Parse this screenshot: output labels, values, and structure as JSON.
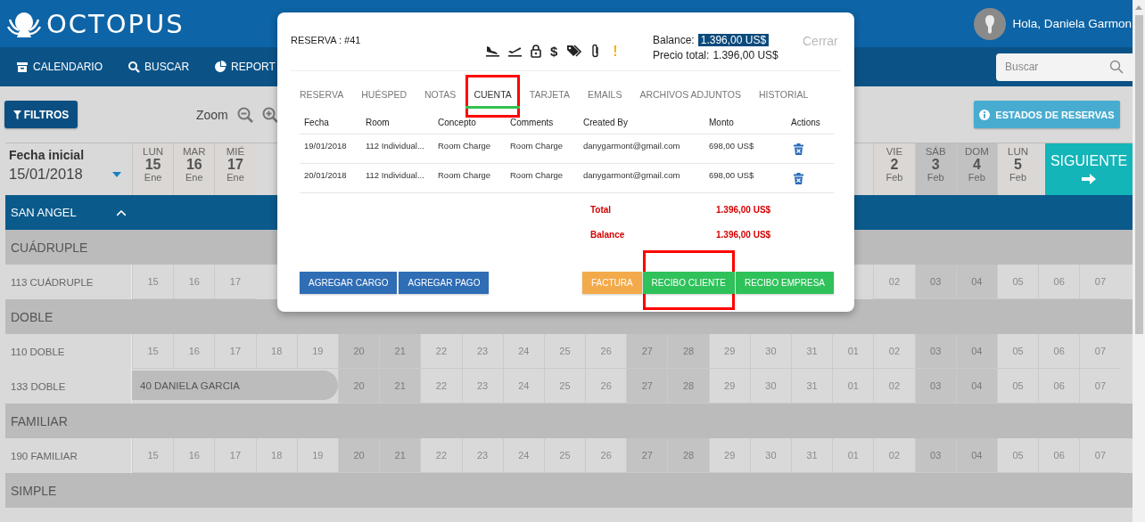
{
  "header": {
    "brand": "OCTOPUS",
    "greeting": "Hola, Daniela Garmon"
  },
  "nav": {
    "items": [
      {
        "label": "CALENDARIO"
      },
      {
        "label": "BUSCAR"
      },
      {
        "label": "REPORT"
      }
    ],
    "search": {
      "placeholder": "Buscar"
    }
  },
  "toolbar": {
    "filter_button": "FILTROS",
    "zoom_label": "Zoom",
    "status_button": "ESTADOS DE RESERVAS"
  },
  "calendar": {
    "start_label": "Fecha inicial",
    "start_date": "15/01/2018",
    "next_button": "SIGUIENTE",
    "days_left": [
      {
        "weekday": "LUN",
        "day": "15",
        "month": "Ene",
        "weekend": false
      },
      {
        "weekday": "MAR",
        "day": "16",
        "month": "Ene",
        "weekend": false
      },
      {
        "weekday": "MIÉ",
        "day": "17",
        "month": "Ene",
        "weekend": false
      }
    ],
    "days_right": [
      {
        "weekday": "VIE",
        "day": "2",
        "month": "Feb",
        "weekend": false
      },
      {
        "weekday": "SÁB",
        "day": "3",
        "month": "Feb",
        "weekend": true
      },
      {
        "weekday": "DOM",
        "day": "4",
        "month": "Feb",
        "weekend": true
      },
      {
        "weekday": "LUN",
        "day": "5",
        "month": "Feb",
        "weekend": false
      }
    ],
    "group": {
      "name": "SAN ANGEL",
      "expanded": true
    },
    "sections": [
      {
        "category": "CUÁDRUPLE",
        "rooms": [
          {
            "name": "113 CUÁDRUPLE",
            "cells_left": [
              {
                "day": "15",
                "weekend": false
              },
              {
                "day": "16",
                "weekend": false
              },
              {
                "day": "17",
                "weekend": false
              }
            ],
            "cells_right": [
              {
                "day": "02",
                "weekend": false
              },
              {
                "day": "03",
                "weekend": true
              },
              {
                "day": "04",
                "weekend": true
              },
              {
                "day": "05",
                "weekend": false
              },
              {
                "day": "06",
                "weekend": false
              },
              {
                "day": "07",
                "weekend": false
              }
            ]
          }
        ]
      },
      {
        "category": "DOBLE",
        "rooms": [
          {
            "name": "110 DOBLE",
            "cells_left": [
              {
                "day": "15",
                "weekend": false
              },
              {
                "day": "16",
                "weekend": false
              },
              {
                "day": "17",
                "weekend": false
              },
              {
                "day": "18",
                "weekend": false
              },
              {
                "day": "19",
                "weekend": false
              },
              {
                "day": "20",
                "weekend": true
              },
              {
                "day": "21",
                "weekend": true
              },
              {
                "day": "22",
                "weekend": false
              },
              {
                "day": "23",
                "weekend": false
              },
              {
                "day": "24",
                "weekend": false
              },
              {
                "day": "25",
                "weekend": false
              },
              {
                "day": "26",
                "weekend": false
              },
              {
                "day": "27",
                "weekend": true
              },
              {
                "day": "28",
                "weekend": true
              },
              {
                "day": "29",
                "weekend": false
              },
              {
                "day": "30",
                "weekend": false
              },
              {
                "day": "31",
                "weekend": false
              },
              {
                "day": "01",
                "weekend": false
              },
              {
                "day": "02",
                "weekend": false
              },
              {
                "day": "03",
                "weekend": true
              },
              {
                "day": "04",
                "weekend": true
              },
              {
                "day": "05",
                "weekend": false
              },
              {
                "day": "06",
                "weekend": false
              },
              {
                "day": "07",
                "weekend": false
              }
            ]
          },
          {
            "name": "133 DOBLE",
            "booking": {
              "label": "40 DANIELA GARCIA"
            },
            "cells_right": [
              {
                "day": "20",
                "weekend": true
              },
              {
                "day": "21",
                "weekend": true
              },
              {
                "day": "22",
                "weekend": false
              },
              {
                "day": "23",
                "weekend": false
              },
              {
                "day": "24",
                "weekend": false
              },
              {
                "day": "25",
                "weekend": false
              },
              {
                "day": "26",
                "weekend": false
              },
              {
                "day": "27",
                "weekend": true
              },
              {
                "day": "28",
                "weekend": true
              },
              {
                "day": "29",
                "weekend": false
              },
              {
                "day": "30",
                "weekend": false
              },
              {
                "day": "31",
                "weekend": false
              },
              {
                "day": "01",
                "weekend": false
              },
              {
                "day": "02",
                "weekend": false
              },
              {
                "day": "03",
                "weekend": true
              },
              {
                "day": "04",
                "weekend": true
              },
              {
                "day": "05",
                "weekend": false
              },
              {
                "day": "06",
                "weekend": false
              },
              {
                "day": "07",
                "weekend": false
              }
            ]
          }
        ]
      },
      {
        "category": "FAMILIAR",
        "rooms": [
          {
            "name": "190 FAMILIAR",
            "cells_left": [
              {
                "day": "15",
                "weekend": false
              },
              {
                "day": "16",
                "weekend": false
              },
              {
                "day": "17",
                "weekend": false
              },
              {
                "day": "18",
                "weekend": false
              },
              {
                "day": "19",
                "weekend": false
              },
              {
                "day": "20",
                "weekend": true
              },
              {
                "day": "21",
                "weekend": true
              },
              {
                "day": "22",
                "weekend": false
              },
              {
                "day": "23",
                "weekend": false
              },
              {
                "day": "24",
                "weekend": false
              },
              {
                "day": "25",
                "weekend": false
              },
              {
                "day": "26",
                "weekend": false
              },
              {
                "day": "27",
                "weekend": true
              },
              {
                "day": "28",
                "weekend": true
              },
              {
                "day": "29",
                "weekend": false
              },
              {
                "day": "30",
                "weekend": false
              },
              {
                "day": "31",
                "weekend": false
              },
              {
                "day": "01",
                "weekend": false
              },
              {
                "day": "02",
                "weekend": false
              },
              {
                "day": "03",
                "weekend": true
              },
              {
                "day": "04",
                "weekend": true
              },
              {
                "day": "05",
                "weekend": false
              },
              {
                "day": "06",
                "weekend": false
              },
              {
                "day": "07",
                "weekend": false
              }
            ]
          }
        ]
      },
      {
        "category": "SIMPLE"
      }
    ]
  },
  "modal": {
    "title": "RESERVA : #41",
    "money_symbol": "$",
    "alert_symbol": "!",
    "balance_label": "Balance:",
    "balance": "1.396,00 US$",
    "total_label": "Precio total:",
    "total": "1.396,00 US$",
    "close": "Cerrar",
    "tabs": [
      {
        "label": "RESERVA",
        "selected": false,
        "annotated": false
      },
      {
        "label": "HUÉSPED",
        "selected": false,
        "annotated": false
      },
      {
        "label": "NOTAS",
        "selected": false,
        "annotated": false
      },
      {
        "label": "CUENTA",
        "selected": true,
        "annotated": true
      },
      {
        "label": "TARJETA",
        "selected": false,
        "annotated": false
      },
      {
        "label": "EMAILS",
        "selected": false,
        "annotated": false
      },
      {
        "label": "ARCHIVOS ADJUNTOS",
        "selected": false,
        "annotated": false
      },
      {
        "label": "HISTORIAL",
        "selected": false,
        "annotated": false
      }
    ],
    "table": {
      "columns": [
        "Fecha",
        "Room",
        "Concepto",
        "Comments",
        "Created By",
        "Monto",
        "Actions"
      ],
      "rows": [
        {
          "cells": [
            "19/01/2018",
            "112 Individual...",
            "Room Charge",
            "Room Charge",
            "danygarmont@gmail.com",
            "698,00 US$"
          ]
        },
        {
          "cells": [
            "20/01/2018",
            "112 Individual...",
            "Room Charge",
            "Room Charge",
            "danygarmont@gmail.com",
            "698,00 US$"
          ]
        }
      ]
    },
    "summary": [
      {
        "label": "Total",
        "value": "1.396,00 US$"
      },
      {
        "label": "Balance",
        "value": "1.396,00 US$"
      }
    ],
    "left_buttons": [
      {
        "label": "AGREGAR CARGO",
        "kind": "primary",
        "annotated": false
      },
      {
        "label": "AGREGAR PAGO",
        "kind": "primary",
        "annotated": false
      }
    ],
    "right_buttons": [
      {
        "label": "FACTURA",
        "kind": "warning",
        "annotated": false
      },
      {
        "label": "RECIBO CLIENTE",
        "kind": "success",
        "annotated": true
      },
      {
        "label": "RECIBO EMPRESA",
        "kind": "success",
        "annotated": false
      }
    ]
  }
}
